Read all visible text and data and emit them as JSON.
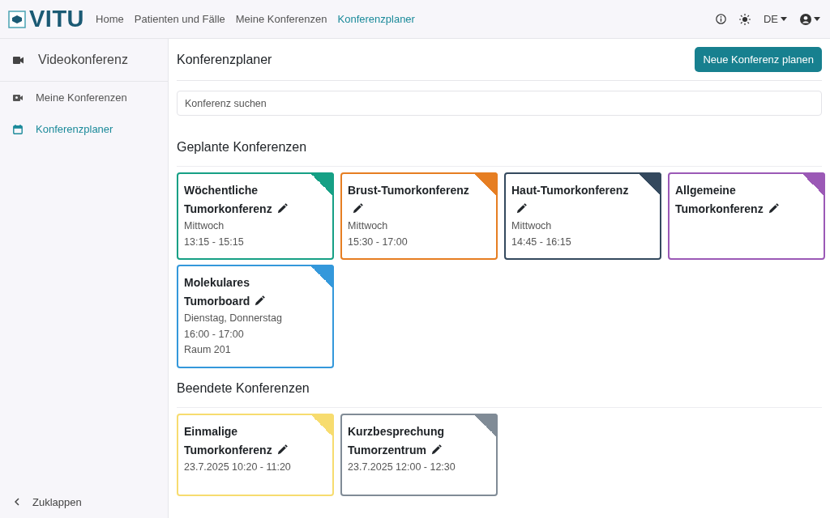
{
  "header": {
    "logo": "VITU",
    "nav": [
      {
        "label": "Home",
        "selected": false
      },
      {
        "label": "Patienten und Fälle",
        "selected": false
      },
      {
        "label": "Meine Konferenzen",
        "selected": false
      },
      {
        "label": "Konferenzplaner",
        "selected": true
      }
    ],
    "language": "DE"
  },
  "sidebar": {
    "title": "Videokonferenz",
    "items": [
      {
        "label": "Meine Konferenzen",
        "selected": false
      },
      {
        "label": "Konferenzplaner",
        "selected": true
      }
    ],
    "collapse": "Zuklappen"
  },
  "main": {
    "title": "Konferenzplaner",
    "new_button": "Neue Konferenz planen",
    "search": {
      "placeholder": "Konferenz suchen"
    },
    "sections": [
      {
        "title": "Geplante Konferenzen",
        "conferences": [
          {
            "title": "Wöchentliche Tumorkonferenz",
            "color": "#16a085",
            "details": [
              "Mittwoch",
              "13:15 - 15:15"
            ]
          },
          {
            "title": "Brust-Tumorkonferenz",
            "color": "#e67e22",
            "details": [
              "Mittwoch",
              "15:30 - 17:00"
            ]
          },
          {
            "title": "Haut-Tumorkonferenz",
            "color": "#34495e",
            "details": [
              "Mittwoch",
              "14:45 - 16:15"
            ]
          },
          {
            "title": "Allgemeine Tumorkonferenz",
            "color": "#9b59b6"
          },
          {
            "title": "Molekulares Tumorboard",
            "color": "#3498db",
            "details": [
              "Dienstag, Donnerstag",
              "16:00 - 17:00",
              "Raum 201"
            ]
          }
        ]
      },
      {
        "title": "Beendete Konferenzen",
        "conferences": [
          {
            "title": "Einmalige Tumorkonferenz",
            "color": "#f7dc6f",
            "details": [
              "23.7.2025 10:20 - 11:20"
            ]
          },
          {
            "title": "Kurzbesprechung Tumorzentrum",
            "color": "#808b96",
            "details": [
              "23.7.2025 12:00 - 12:30"
            ]
          }
        ]
      }
    ]
  }
}
